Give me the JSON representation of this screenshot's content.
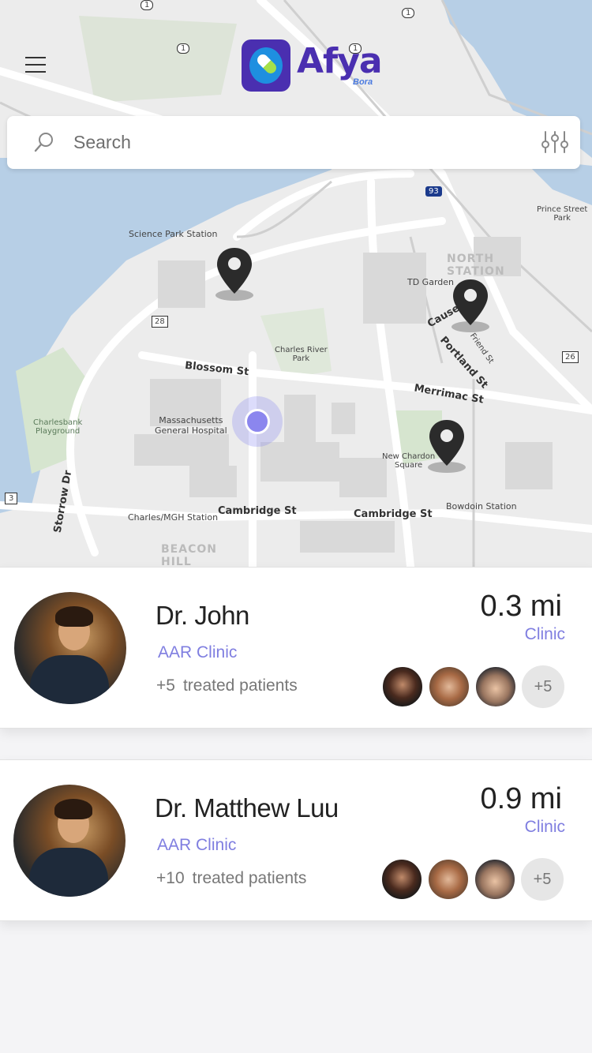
{
  "app": {
    "logo_text": "Afya",
    "logo_sub": "Bora"
  },
  "search": {
    "placeholder": "Search"
  },
  "map": {
    "labels": {
      "science_park": "Science Park Station",
      "north_station": "NORTH\nSTATION",
      "td_garden": "TD Garden",
      "prince_street_park": "Prince Street\nPark",
      "charles_river_park": "Charles River\nPark",
      "blossom_st": "Blossom St",
      "mass_general": "Massachusetts\nGeneral Hospital",
      "charlesbank": "Charlesbank\nPlayground",
      "new_chardon": "New Chardon\nSquare",
      "bowdoin": "Bowdoin Station",
      "charles_mgh": "Charles/MGH Station",
      "cambridge_st_1": "Cambridge St",
      "cambridge_st_2": "Cambridge St",
      "merrimac_st": "Merrimac St",
      "portland_st": "Portland St",
      "causeway": "Causeway",
      "friend_st": "Friend St",
      "storrow_dr": "Storrow Dr",
      "beacon_hill": "BEACON\nHILL",
      "shield_28": "28",
      "shield_3": "3",
      "shield_26": "26",
      "shield_93": "93",
      "shield_1a": "1",
      "shield_1b": "1",
      "shield_1c": "1",
      "shield_1d": "1"
    }
  },
  "doctors": [
    {
      "name": "Dr. John",
      "clinic": "AAR Clinic",
      "treated_count": "+5",
      "treated_label": "treated patients",
      "distance": "0.3 mi",
      "type": "Clinic",
      "more_label": "+5"
    },
    {
      "name": "Dr. Matthew Luu",
      "clinic": "AAR Clinic",
      "treated_count": "+10",
      "treated_label": "treated patients",
      "distance": "0.9 mi",
      "type": "Clinic",
      "more_label": "+5"
    }
  ],
  "colors": {
    "accent": "#7f7ee0",
    "brand": "#4a2fb0",
    "water": "#b7cfe6",
    "park": "#d6e5cf"
  }
}
